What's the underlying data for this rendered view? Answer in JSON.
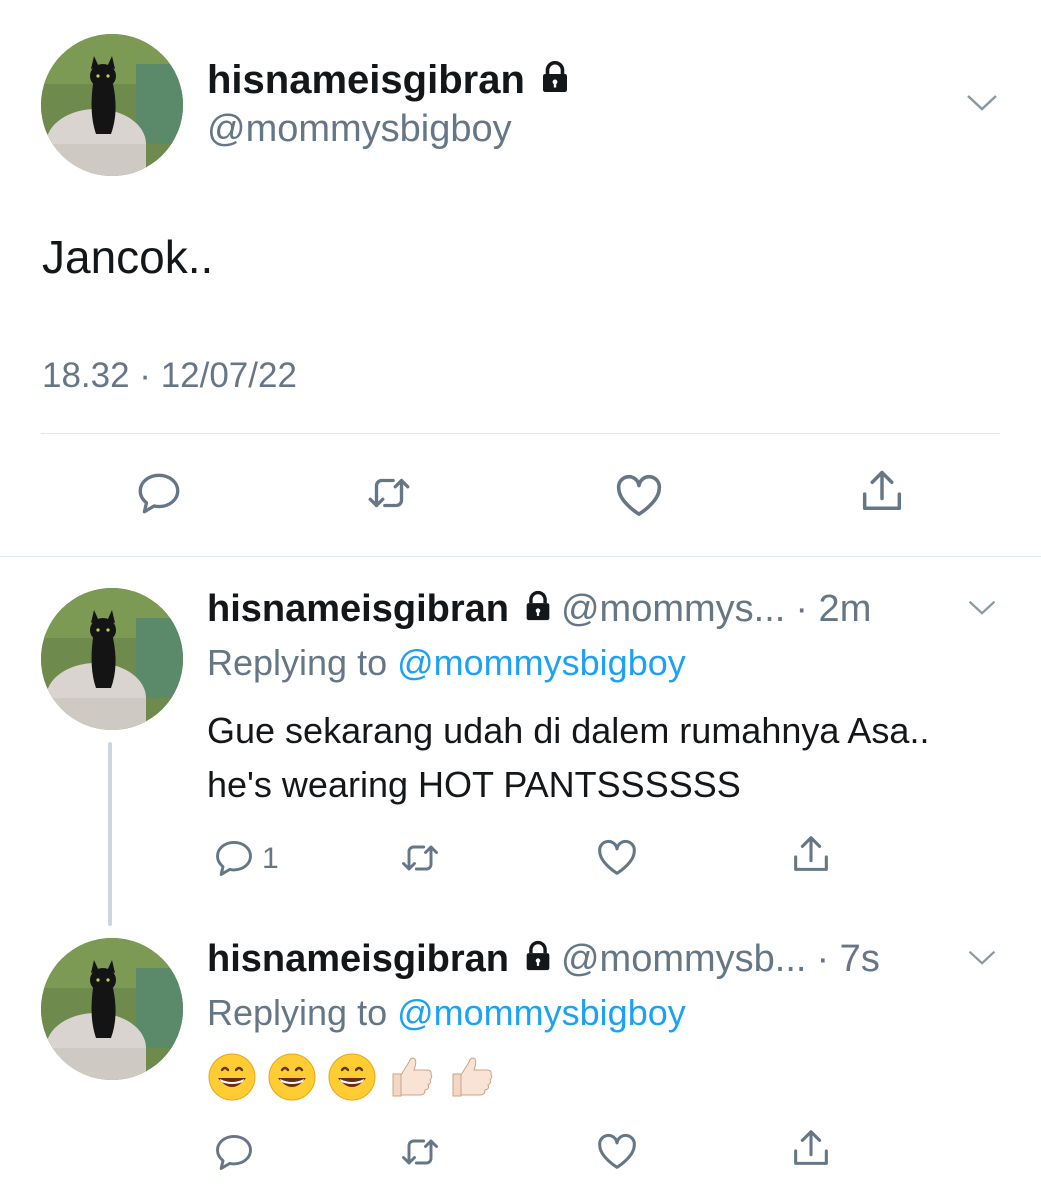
{
  "main_tweet": {
    "display_name": "hisnameisgibran",
    "handle": "@mommysbigboy",
    "text": "Jancok..",
    "timestamp": "18.32 · 12/07/22",
    "protected": true
  },
  "replies": [
    {
      "display_name": "hisnameisgibran",
      "handle": "@mommys...",
      "time": "· 2m",
      "replying_prefix": "Replying to",
      "replying_to": "@mommysbigboy",
      "text": "Gue sekarang udah di dalem rumahnya Asa.. he's wearing HOT PANTSSSSSS",
      "reply_count": "1"
    },
    {
      "display_name": "hisnameisgibran",
      "handle": "@mommysb...",
      "time": "· 7s",
      "replying_prefix": "Replying to",
      "replying_to": "@mommysbigboy",
      "emojis": [
        "grinning-face",
        "grinning-face",
        "grinning-face",
        "thumbs-up-light",
        "thumbs-up-light"
      ]
    }
  ],
  "colors": {
    "text_primary": "#14171a",
    "text_secondary": "#657786",
    "accent": "#1da1f2",
    "divider": "#e1e8ed",
    "thread_line": "#ccd6dd"
  }
}
